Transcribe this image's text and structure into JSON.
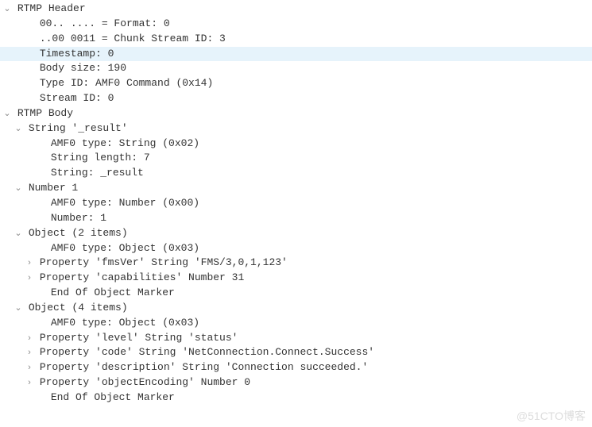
{
  "tree": [
    {
      "indent": 0,
      "toggle": "open",
      "label": "RTMP Header",
      "highlighted": false
    },
    {
      "indent": 2,
      "toggle": "none",
      "label": "00.. .... = Format: 0",
      "highlighted": false
    },
    {
      "indent": 2,
      "toggle": "none",
      "label": "..00 0011 = Chunk Stream ID: 3",
      "highlighted": false
    },
    {
      "indent": 2,
      "toggle": "none",
      "label": "Timestamp: 0",
      "highlighted": true
    },
    {
      "indent": 2,
      "toggle": "none",
      "label": "Body size: 190",
      "highlighted": false
    },
    {
      "indent": 2,
      "toggle": "none",
      "label": "Type ID: AMF0 Command (0x14)",
      "highlighted": false
    },
    {
      "indent": 2,
      "toggle": "none",
      "label": "Stream ID: 0",
      "highlighted": false
    },
    {
      "indent": 0,
      "toggle": "open",
      "label": "RTMP Body",
      "highlighted": false
    },
    {
      "indent": 1,
      "toggle": "open",
      "label": "String '_result'",
      "highlighted": false
    },
    {
      "indent": 3,
      "toggle": "none",
      "label": "AMF0 type: String (0x02)",
      "highlighted": false
    },
    {
      "indent": 3,
      "toggle": "none",
      "label": "String length: 7",
      "highlighted": false
    },
    {
      "indent": 3,
      "toggle": "none",
      "label": "String: _result",
      "highlighted": false
    },
    {
      "indent": 1,
      "toggle": "open",
      "label": "Number 1",
      "highlighted": false
    },
    {
      "indent": 3,
      "toggle": "none",
      "label": "AMF0 type: Number (0x00)",
      "highlighted": false
    },
    {
      "indent": 3,
      "toggle": "none",
      "label": "Number: 1",
      "highlighted": false
    },
    {
      "indent": 1,
      "toggle": "open",
      "label": "Object (2 items)",
      "highlighted": false
    },
    {
      "indent": 3,
      "toggle": "none",
      "label": "AMF0 type: Object (0x03)",
      "highlighted": false
    },
    {
      "indent": 2,
      "toggle": "closed",
      "label": "Property 'fmsVer' String 'FMS/3,0,1,123'",
      "highlighted": false
    },
    {
      "indent": 2,
      "toggle": "closed",
      "label": "Property 'capabilities' Number 31",
      "highlighted": false
    },
    {
      "indent": 3,
      "toggle": "none",
      "label": "End Of Object Marker",
      "highlighted": false
    },
    {
      "indent": 1,
      "toggle": "open",
      "label": "Object (4 items)",
      "highlighted": false
    },
    {
      "indent": 3,
      "toggle": "none",
      "label": "AMF0 type: Object (0x03)",
      "highlighted": false
    },
    {
      "indent": 2,
      "toggle": "closed",
      "label": "Property 'level' String 'status'",
      "highlighted": false
    },
    {
      "indent": 2,
      "toggle": "closed",
      "label": "Property 'code' String 'NetConnection.Connect.Success'",
      "highlighted": false
    },
    {
      "indent": 2,
      "toggle": "closed",
      "label": "Property 'description' String 'Connection succeeded.'",
      "highlighted": false
    },
    {
      "indent": 2,
      "toggle": "closed",
      "label": "Property 'objectEncoding' Number 0",
      "highlighted": false
    },
    {
      "indent": 3,
      "toggle": "none",
      "label": "End Of Object Marker",
      "highlighted": false
    }
  ],
  "toggle_glyphs": {
    "open": "⌄",
    "closed": "›",
    "none": " "
  },
  "watermark": "@51CTO博客"
}
